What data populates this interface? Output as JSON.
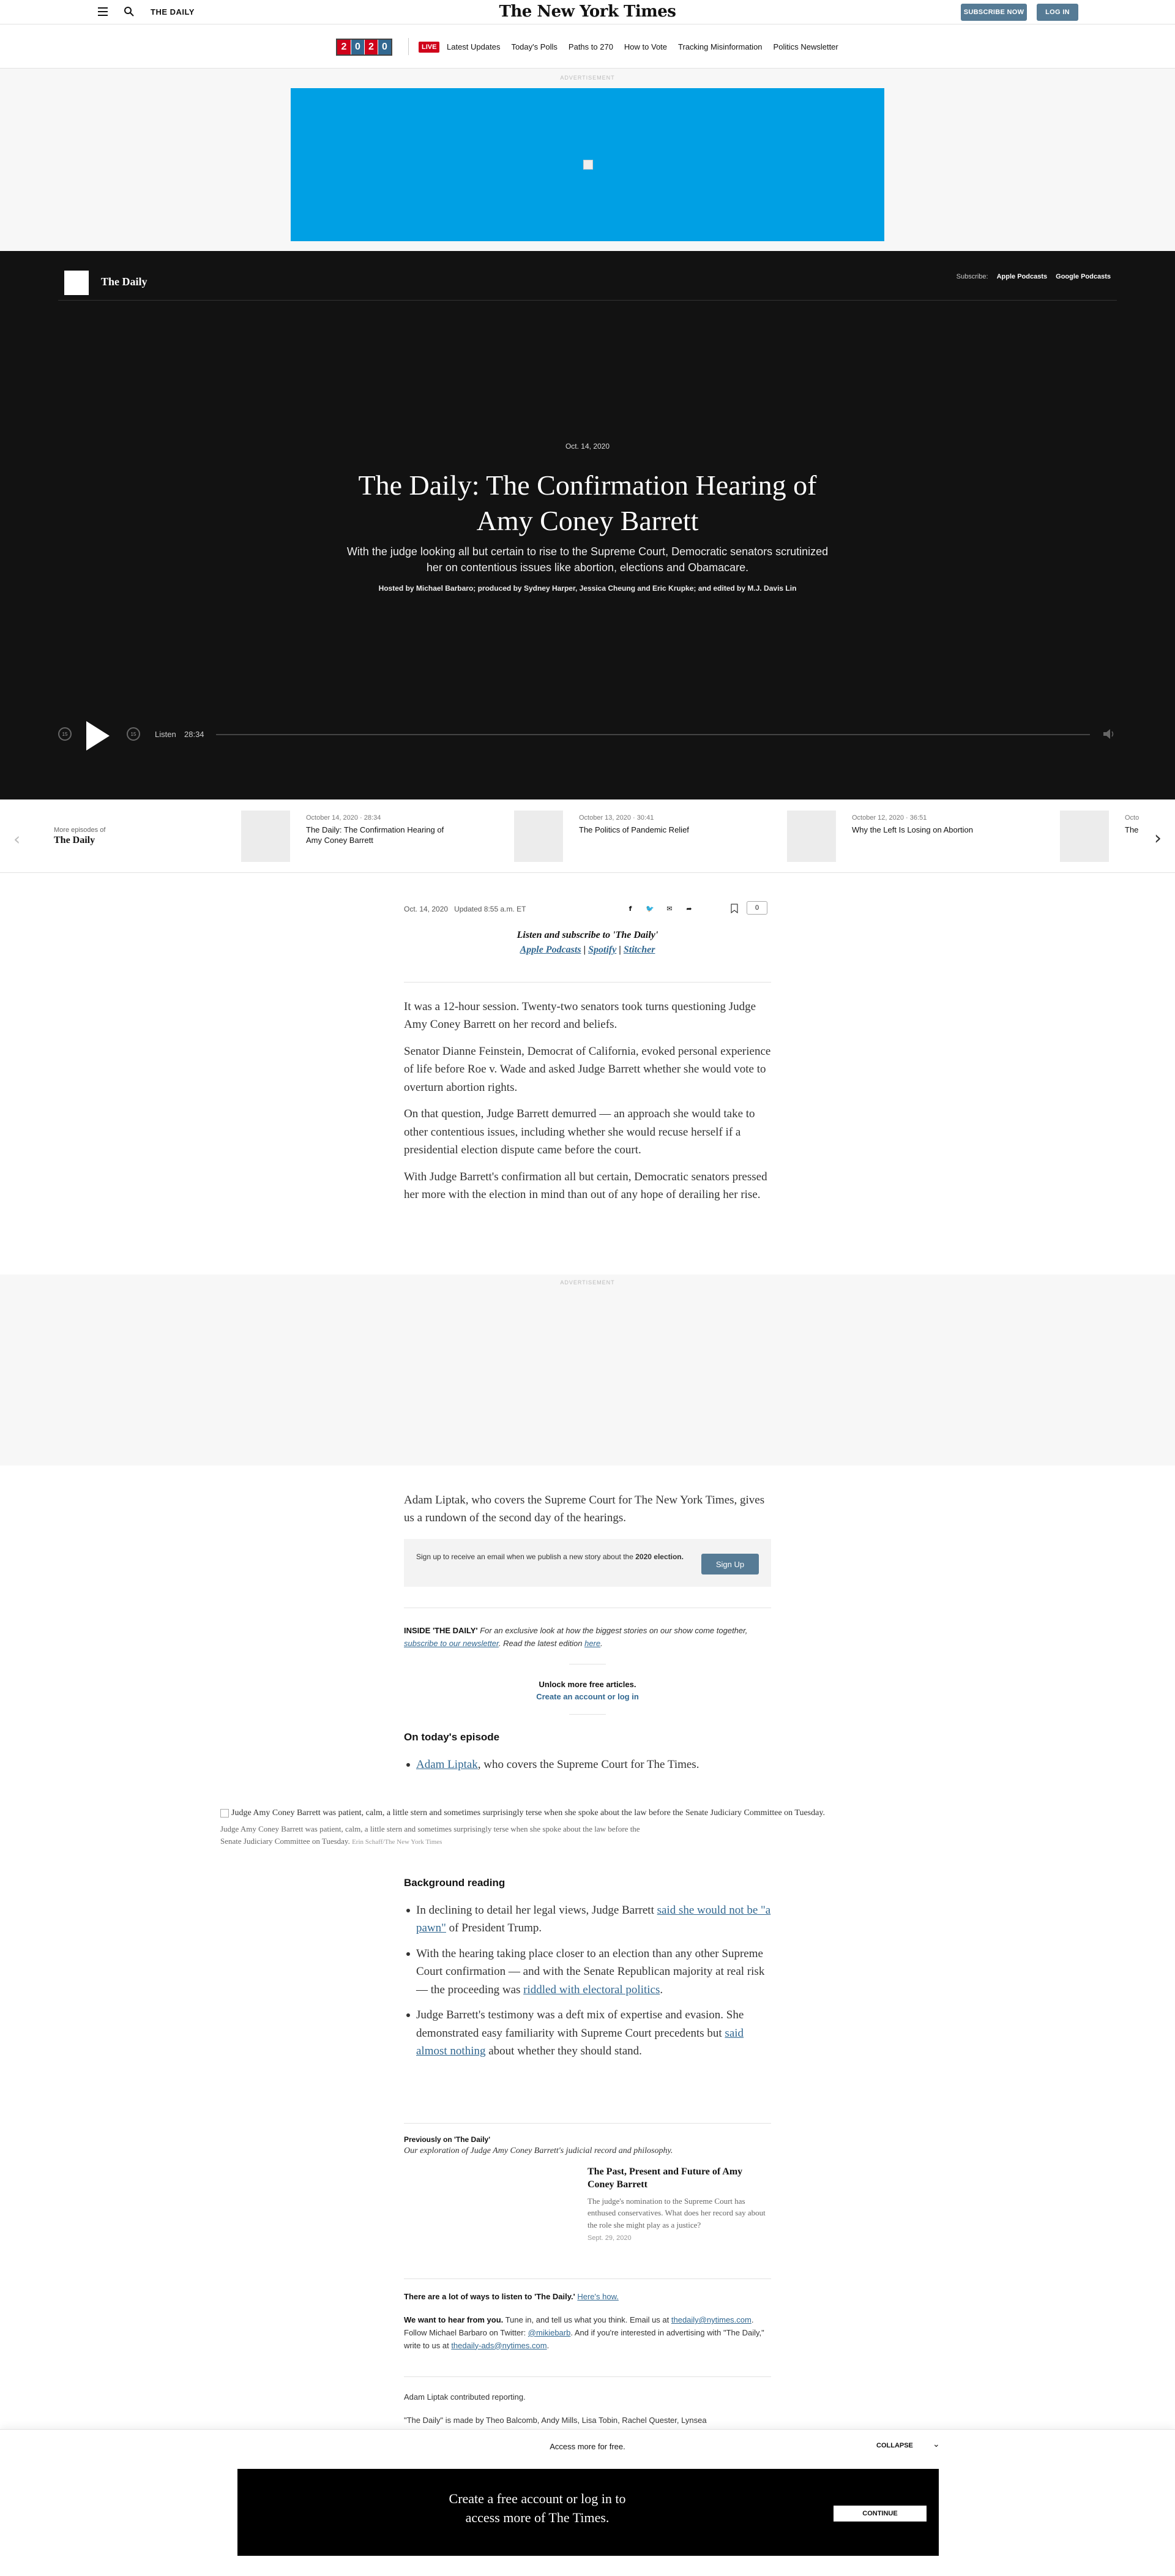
{
  "masthead": {
    "section": "THE DAILY",
    "logo": "The New York Times",
    "subscribe": "SUBSCRIBE NOW",
    "login": "LOG IN"
  },
  "election_bar": {
    "year_digits": [
      "2",
      "0",
      "2",
      "0"
    ],
    "year_colors": [
      "#d0021b",
      "#326891",
      "#d0021b",
      "#326891"
    ],
    "live": "LIVE",
    "links": [
      "Latest Updates",
      "Today's Polls",
      "Paths to 270",
      "How to Vote",
      "Tracking Misinformation",
      "Politics Newsletter"
    ]
  },
  "ad": {
    "label": "Advertisement",
    "color": "#00a0e4"
  },
  "hero": {
    "show": "The Daily",
    "subscribe_label": "Subscribe:",
    "subscribe_apple": "Apple Podcasts",
    "subscribe_google": "Google Podcasts",
    "date": "Oct. 14, 2020",
    "title": "The Daily: The Confirmation Hearing of Amy Coney Barrett",
    "dek": "With the judge looking all but certain to rise to the Supreme Court, Democratic senators scrutinized her on contentious issues like abortion, elections and Obamacare.",
    "credit": "Hosted by Michael Barbaro; produced by Sydney Harper, Jessica Cheung and Eric Krupke; and edited by M.J. Davis Lin"
  },
  "player": {
    "back": "15",
    "fwd": "15",
    "listen": "Listen",
    "duration": "28:34"
  },
  "episodes": {
    "more_label": "More episodes of",
    "more_show": "The Daily",
    "items": [
      {
        "meta": "October 14, 2020  ·  28:34",
        "title": "The Daily: The Confirmation Hearing of Amy Coney Barrett"
      },
      {
        "meta": "October 13, 2020  ·  30:41",
        "title": "The Politics of Pandemic Relief"
      },
      {
        "meta": "October 12, 2020  ·  36:51",
        "title": "Why the Left Is Losing on Abortion"
      },
      {
        "meta": "Octo",
        "title": "The"
      }
    ]
  },
  "article": {
    "timestamp": "Oct. 14, 2020",
    "updated": "Updated 8:55 a.m. ET",
    "comment_count": "0",
    "listen_heading": "Listen and subscribe to 'The Daily'",
    "listen_links": [
      "Apple Podcasts",
      "Spotify",
      "Stitcher"
    ],
    "listen_sep": "|",
    "paragraphs": [
      "It was a 12-hour session. Twenty-two senators took turns questioning Judge Amy Coney Barrett on her record and beliefs.",
      "Senator Dianne Feinstein, Democrat of California, evoked personal experience of life before Roe v. Wade and asked Judge Barrett whether she would vote to overturn abortion rights.",
      "On that question, Judge Barrett demurred — an approach she would take to other contentious issues, including whether she would recuse herself if a presidential election dispute came before the court.",
      "With Judge Barrett's confirmation all but certain, Democratic senators pressed her more with the election in mind than out of any hope of derailing her rise."
    ],
    "after_ad": "Adam Liptak, who covers the Supreme Court for The New York Times, gives us a rundown of the second day of the hearings.",
    "signup_text_1": "Sign up to receive an email when we publish a new story about the",
    "signup_text_bold": "2020 election.",
    "signup_button": "Sign Up",
    "inside_label": "INSIDE 'THE DAILY'",
    "inside_text": "For an exclusive look at how the biggest stories on our show come together,",
    "inside_link": "subscribe to our newsletter",
    "inside_text2": ". Read the latest edition",
    "inside_link2": "here",
    "unlock_1": "Unlock more free articles.",
    "unlock_2": "Create an account or log in",
    "todays_heading": "On today's episode",
    "todays_link": "Adam Liptak",
    "todays_rest": ", who covers the Supreme Court for The Times.",
    "photo_alt": "Judge Amy Coney Barrett was patient, calm, a little stern and sometimes surprisingly terse when she spoke about the law before the Senate Judiciary Committee on Tuesday.",
    "photo_caption": "Judge Amy Coney Barrett was patient, calm, a little stern and sometimes surprisingly terse when she spoke about the law before the Senate Judiciary Committee on Tuesday.",
    "photo_credit": "Erin Schaff/The New York Times",
    "bg_heading": "Background reading",
    "bg1_a": "In declining to detail her legal views, Judge Barrett ",
    "bg1_link": "said she would not be \"a pawn\"",
    "bg1_b": " of President Trump.",
    "bg2_a": "With the hearing taking place closer to an election than any other Supreme Court confirmation — and with the Senate Republican majority at real risk — the proceeding was ",
    "bg2_link": "riddled with electoral politics",
    "bg2_b": ".",
    "bg3_a": "Judge Barrett's testimony was a deft mix of expertise and evasion. She demonstrated easy familiarity with Supreme Court precedents but ",
    "bg3_link": "said almost nothing",
    "bg3_b": " about whether they should stand.",
    "prev_heading": "Previously on 'The Daily'",
    "prev_sub": "Our exploration of Judge Amy Coney Barrett's judicial record and philosophy.",
    "prev_title": "The Past, Present and Future of Amy Coney Barrett",
    "prev_summary": "The judge's nomination to the Supreme Court has enthused conservatives. What does her record say about the role she might play as a justice?",
    "prev_date": "Sept. 29, 2020",
    "ways": "There are a lot of ways to listen to 'The Daily.'",
    "ways_link": "Here's how.",
    "hear_bold": "We want to hear from you.",
    "hear_a": " Tune in, and tell us what you think. Email us at ",
    "hear_email": "thedaily@nytimes.com",
    "hear_b": ". Follow Michael Barbaro on Twitter: ",
    "hear_tw": "@mikiebarb",
    "hear_c": ". And if you're interested in advertising with \"The Daily,\" write to us at ",
    "hear_ads": "thedaily-ads@nytimes.com",
    "hear_d": ".",
    "contrib": "Adam Liptak contributed reporting.",
    "made_by": "\"The Daily\" is made by Theo Balcomb, Andy Mills, Lisa Tobin, Rachel Quester, Lynsea"
  },
  "gateway": {
    "access": "Access more for free.",
    "collapse": "COLLAPSE",
    "message": "Create a free account or log in to access more of The Times.",
    "continue": "CONTINUE"
  }
}
